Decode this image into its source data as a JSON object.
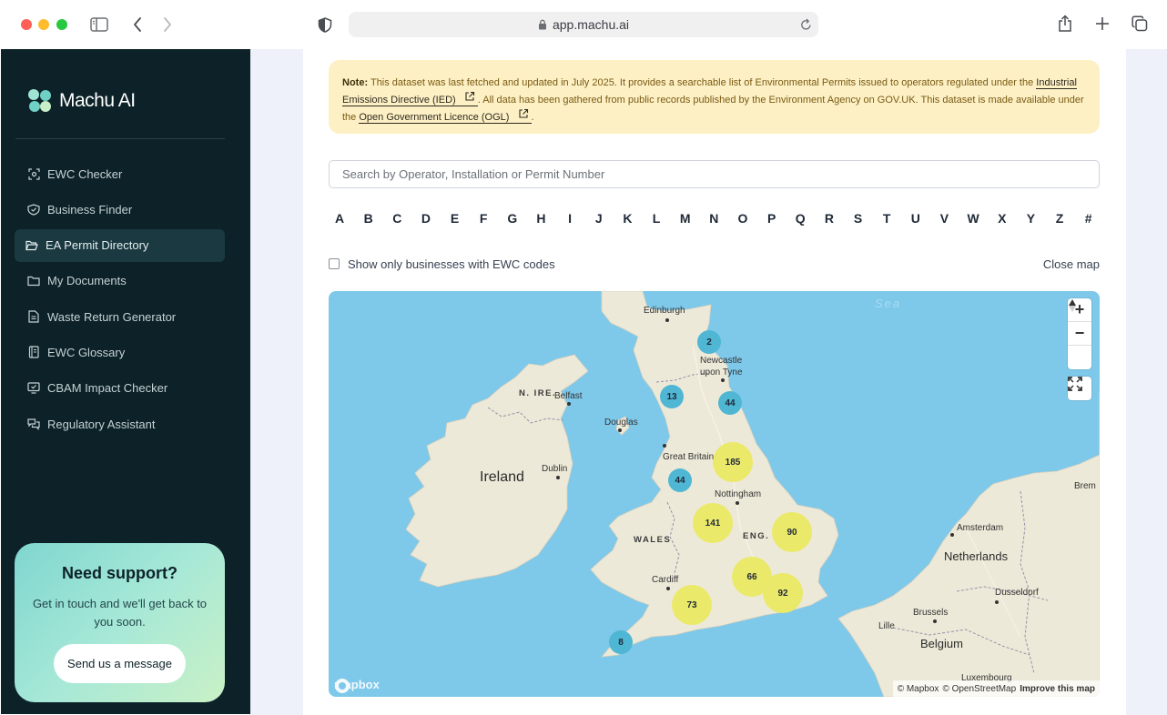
{
  "browser": {
    "url": "app.machu.ai",
    "traffic_colors": [
      "#fe5f57",
      "#febc2e",
      "#28c840"
    ]
  },
  "sidebar": {
    "brand": "Machu AI",
    "items": [
      {
        "label": "EWC Checker",
        "icon": "scan-icon",
        "active": false
      },
      {
        "label": "Business Finder",
        "icon": "badge-icon",
        "active": false
      },
      {
        "label": "EA Permit Directory",
        "icon": "folder-open-icon",
        "active": true
      },
      {
        "label": "My Documents",
        "icon": "folder-icon",
        "active": false
      },
      {
        "label": "Waste Return Generator",
        "icon": "file-text-icon",
        "active": false
      },
      {
        "label": "EWC Glossary",
        "icon": "book-icon",
        "active": false
      },
      {
        "label": "CBAM Impact Checker",
        "icon": "monitor-check-icon",
        "active": false
      },
      {
        "label": "Regulatory Assistant",
        "icon": "chat-icon",
        "active": false
      }
    ],
    "support": {
      "title": "Need support?",
      "text": "Get in touch and we'll get back to you soon.",
      "button": "Send us a message"
    }
  },
  "notice": {
    "label": "Note:",
    "text1": "This dataset was last fetched and updated in July 2025. It provides a searchable list of Environmental Permits issued to operators regulated under the",
    "link1": "Industrial Emissions Directive (IED)",
    "text2": ". All data has been gathered from public records published by the Environment Agency on GOV.UK. This dataset is made available under the",
    "link2": "Open Government Licence (OGL)",
    "text3": "."
  },
  "search": {
    "placeholder": "Search by Operator, Installation or Permit Number",
    "value": ""
  },
  "alphabet": [
    "A",
    "B",
    "C",
    "D",
    "E",
    "F",
    "G",
    "H",
    "I",
    "J",
    "K",
    "L",
    "M",
    "N",
    "O",
    "P",
    "Q",
    "R",
    "S",
    "T",
    "U",
    "V",
    "W",
    "X",
    "Y",
    "Z",
    "#"
  ],
  "filter": {
    "checkbox_label": "Show only businesses with EWC codes",
    "checked": false
  },
  "close_map": "Close map",
  "map": {
    "place_labels": {
      "sea": "Sea",
      "edinburgh": "Edinburgh",
      "newcastle_1": "Newcastle",
      "newcastle_2": "upon Tyne",
      "n_ire": "N. IRE.",
      "belfast": "Belfast",
      "douglas": "Douglas",
      "ireland": "Ireland",
      "dublin": "Dublin",
      "great_britain": "Great Britain",
      "nottingham": "Nottingham",
      "wales": "WALES",
      "eng": "ENG.",
      "cardiff": "Cardiff",
      "amsterdam": "Amsterdam",
      "netherlands": "Netherlands",
      "brem": "Brem",
      "dusseldorf": "Dusseldorf",
      "brussels": "Brussels",
      "lille": "Lille",
      "belgium": "Belgium",
      "luxembourg": "Luxembourg"
    },
    "clusters": {
      "edinburgh_area": "2",
      "newcastle_area": "44",
      "cumbria_area": "13",
      "yorkshire_area": "185",
      "liverpool_area": "44",
      "midlands_area": "141",
      "east_anglia_area": "90",
      "london_north_area": "66",
      "london_area": "92",
      "southwest_area": "73",
      "cornwall_area": "8"
    },
    "controls": {
      "zoom_in": "+",
      "zoom_out": "−"
    },
    "attribution": {
      "mapbox": "© Mapbox",
      "osm": "© OpenStreetMap",
      "improve": "Improve this map"
    },
    "logo": "mapbox",
    "colors": {
      "water": "#7ec8ea",
      "land": "#ede9d8",
      "cluster_small": "#4fb6d4",
      "cluster_large": "#ebe96a"
    }
  }
}
